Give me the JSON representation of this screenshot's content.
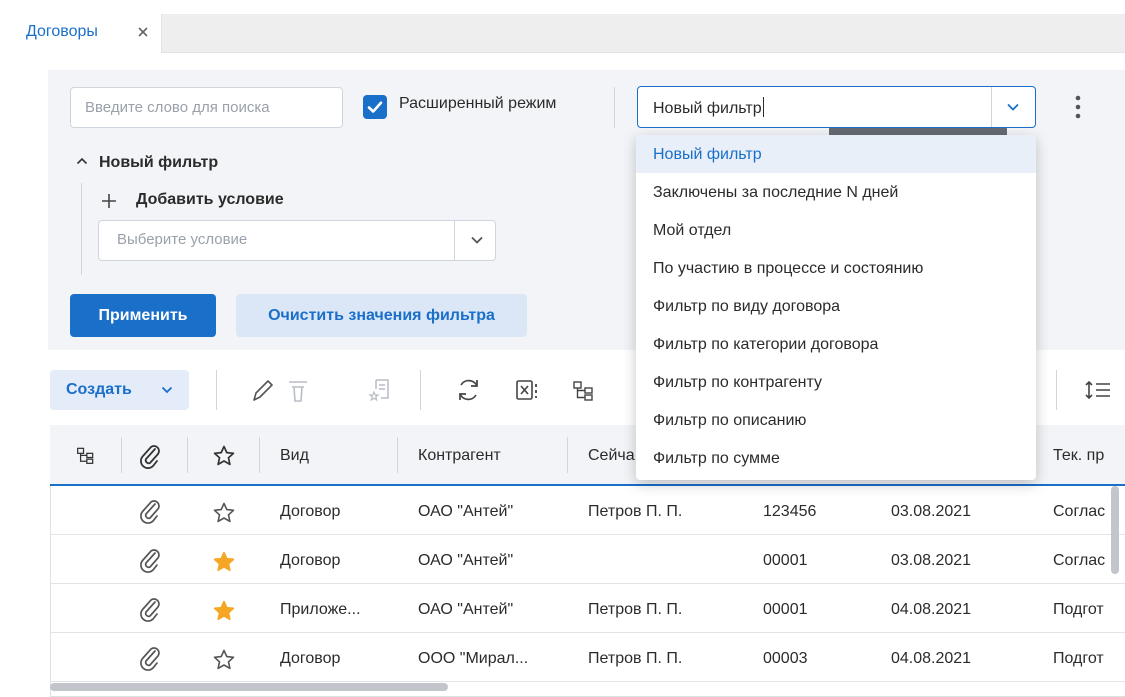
{
  "tabs": [
    {
      "label": "Договоры",
      "close": "×"
    }
  ],
  "filter": {
    "search_placeholder": "Введите слово для поиска",
    "extended_mode_label": "Расширенный режим",
    "extended_mode_checked": true,
    "selected_filter": "Новый фильтр",
    "group_title": "Новый фильтр",
    "add_condition_label": "Добавить условие",
    "condition_placeholder": "Выберите условие",
    "apply_label": "Применить",
    "clear_label": "Очистить значения фильтра"
  },
  "dropdown": {
    "items": [
      "Новый фильтр",
      "Заключены за последние N дней",
      "Мой отдел",
      "По участию в процессе и состоянию",
      "Фильтр по виду договора",
      "Фильтр по категории договора",
      "Фильтр по контрагенту",
      "Фильтр по описанию",
      "Фильтр по сумме"
    ],
    "selected_index": 0
  },
  "toolbar": {
    "create_label": "Создать",
    "icons": [
      "edit-icon",
      "delete-icon",
      "document-star-icon",
      "refresh-icon",
      "export-excel-icon",
      "hierarchy-icon",
      "row-height-icon"
    ]
  },
  "table": {
    "columns": [
      "Вид",
      "Контрагент",
      "Сейча",
      "Тек. пр"
    ],
    "rows": [
      {
        "starred": false,
        "kind": "Договор",
        "counterparty": "ОАО \"Антей\"",
        "person": "Петров П. П.",
        "number": "123456",
        "date": "03.08.2021",
        "stage": "Соглас"
      },
      {
        "starred": true,
        "kind": "Договор",
        "counterparty": "ОАО \"Антей\"",
        "person": "",
        "number": "00001",
        "date": "03.08.2021",
        "stage": "Соглас"
      },
      {
        "starred": true,
        "kind": "Приложе...",
        "counterparty": "ОАО \"Антей\"",
        "person": "Петров П. П.",
        "number": "00001",
        "date": "04.08.2021",
        "stage": "Подгот"
      },
      {
        "starred": false,
        "kind": "Договор",
        "counterparty": "ООО \"Мирал...",
        "person": "Петров П. П.",
        "number": "00003",
        "date": "04.08.2021",
        "stage": "Подгот"
      }
    ]
  },
  "colors": {
    "accent": "#1a6fc9",
    "star": "#f5a623",
    "panel": "#f2f4f7"
  }
}
